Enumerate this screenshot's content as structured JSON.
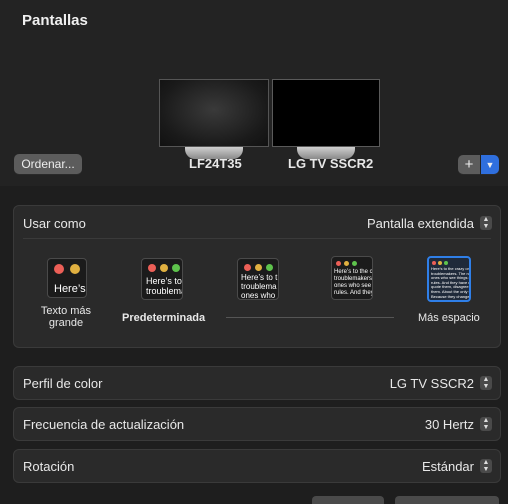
{
  "header": {
    "title": "Pantallas"
  },
  "displays": [
    {
      "name": "LF24T35"
    },
    {
      "name": "LG TV SSCR2"
    }
  ],
  "arrange_button": {
    "label": "Ordenar..."
  },
  "add_button": {
    "label": "+"
  },
  "usar_como": {
    "label": "Usar como",
    "value": "Pantalla extendida"
  },
  "resolution": {
    "options": [
      {
        "preview_text": "Here’s",
        "label": "Texto más grande"
      },
      {
        "preview_text": "Here’s to t\ntroublemak",
        "label": "Predeterminada"
      },
      {
        "preview_text": "Here’s to t\ntroublema\nones who",
        "label": ""
      },
      {
        "preview_text": "Here’s to the c\ntroublemakers.\nones who see th\nrules. And they",
        "label": ""
      },
      {
        "preview_text": "Here’s to the crazy one\ntroublemakers. The ro\nones who see things di\nrules. And they have no\nquote them, disagree w\nthem. About the only th\nBecause they change th",
        "label": "Más espacio"
      }
    ],
    "selected_index": 4
  },
  "perfil_color": {
    "label": "Perfil de color",
    "value": "LG TV SSCR2"
  },
  "frecuencia": {
    "label": "Frecuencia de actualización",
    "value": "30 Hertz"
  },
  "rotacion": {
    "label": "Rotación",
    "value": "Estándar"
  },
  "colors": {
    "accent": "#2f6fde",
    "red": "#ec5f57",
    "yellow": "#e0b040",
    "green": "#5ec34c"
  },
  "icons": [
    "apple-logo-icon",
    "plus-icon",
    "chevron-down-icon",
    "updown-chevron-icon"
  ]
}
